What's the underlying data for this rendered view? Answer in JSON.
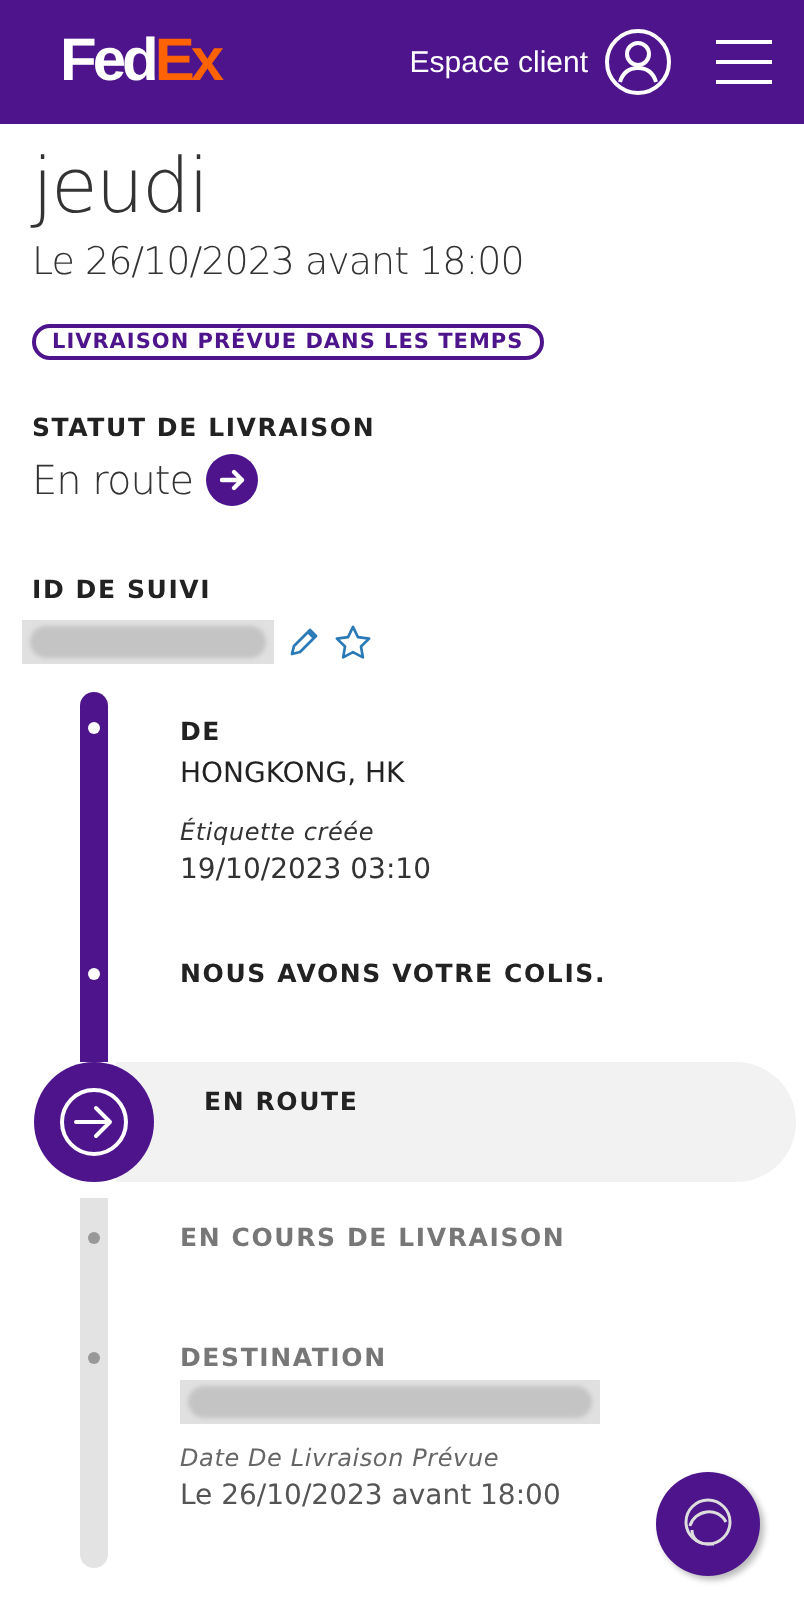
{
  "header": {
    "logo": {
      "primary": "Fed",
      "accent": "Ex"
    },
    "account_label": "Espace client"
  },
  "delivery": {
    "day": "jeudi",
    "date": "Le 26/10/2023 avant 18:00",
    "badge": "LIVRAISON PRÉVUE DANS LES TEMPS"
  },
  "status": {
    "heading": "STATUT DE LIVRAISON",
    "value": "En route"
  },
  "tracking": {
    "heading": "ID DE SUIVI",
    "redacted": true
  },
  "timeline": [
    {
      "kind": "done",
      "title": "DE",
      "place": "HONGKONG, HK",
      "note": "Étiquette créée",
      "time": "19/10/2023 03:10"
    },
    {
      "kind": "done",
      "title": "NOUS AVONS VOTRE COLIS."
    },
    {
      "kind": "current",
      "title": "EN ROUTE"
    },
    {
      "kind": "pending",
      "title": "EN COURS DE LIVRAISON"
    },
    {
      "kind": "pending",
      "title": "DESTINATION",
      "redacted": true,
      "note": "Date De Livraison Prévue",
      "time": "Le 26/10/2023 avant 18:00"
    }
  ]
}
